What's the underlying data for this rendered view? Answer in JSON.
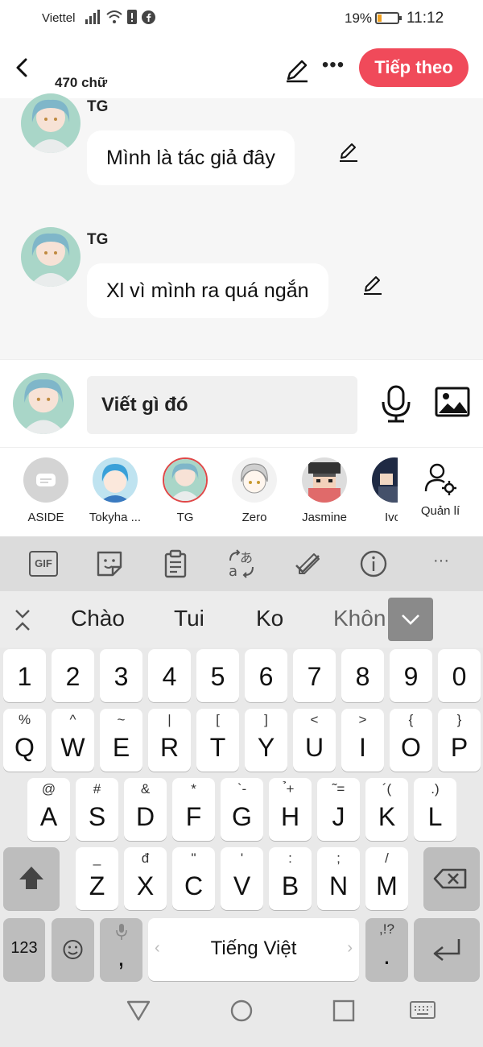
{
  "status_bar": {
    "carrier": "Viettel",
    "battery": "19%",
    "time": "11:12"
  },
  "header": {
    "word_count": "470 chữ",
    "next_button": "Tiếp theo"
  },
  "messages": [
    {
      "author": "TG",
      "text": "Mình là tác giả đây"
    },
    {
      "author": "TG",
      "text": "Xl vì mình ra quá ngắn"
    }
  ],
  "composer": {
    "placeholder": "Viết gì đó"
  },
  "characters": [
    {
      "name": "ASIDE"
    },
    {
      "name": "Tokyha ..."
    },
    {
      "name": "TG"
    },
    {
      "name": "Zero"
    },
    {
      "name": "Jasmine"
    },
    {
      "name": "Ivo"
    },
    {
      "name": "Quản lí"
    }
  ],
  "keyboard": {
    "suggestions": [
      "Chào",
      "Tui",
      "Ko",
      "Khôn"
    ],
    "toolbar_labels": {
      "gif": "GIF"
    },
    "row_numbers": [
      "1",
      "2",
      "3",
      "4",
      "5",
      "6",
      "7",
      "8",
      "9",
      "0"
    ],
    "row1": [
      {
        "k": "Q",
        "s": "%"
      },
      {
        "k": "W",
        "s": "^"
      },
      {
        "k": "E",
        "s": "~"
      },
      {
        "k": "R",
        "s": "|"
      },
      {
        "k": "T",
        "s": "["
      },
      {
        "k": "Y",
        "s": "]"
      },
      {
        "k": "U",
        "s": "<"
      },
      {
        "k": "I",
        "s": ">"
      },
      {
        "k": "O",
        "s": "{"
      },
      {
        "k": "P",
        "s": "}"
      }
    ],
    "row2": [
      {
        "k": "A",
        "s": "@"
      },
      {
        "k": "S",
        "s": "#"
      },
      {
        "k": "D",
        "s": "&"
      },
      {
        "k": "F",
        "s": "*"
      },
      {
        "k": "G",
        "s": "`-"
      },
      {
        "k": "H",
        "s": "̉+"
      },
      {
        "k": "J",
        "s": "˜="
      },
      {
        "k": "K",
        "s": "´("
      },
      {
        "k": "L",
        "s": ".)"
      }
    ],
    "row3": [
      {
        "k": "Z",
        "s": "_"
      },
      {
        "k": "X",
        "s": "đ"
      },
      {
        "k": "C",
        "s": "\""
      },
      {
        "k": "V",
        "s": "'"
      },
      {
        "k": "B",
        "s": ":"
      },
      {
        "k": "N",
        "s": ";"
      },
      {
        "k": "M",
        "s": "/"
      }
    ],
    "num_key": "123",
    "comma": ",",
    "space_label": "Tiếng Việt",
    "punct_top": ",!?",
    "punct_main": "."
  },
  "colors": {
    "accent": "#f04a5a",
    "chat_bg": "#f6f6f6",
    "keyboard_bg": "#e9e9e9"
  }
}
